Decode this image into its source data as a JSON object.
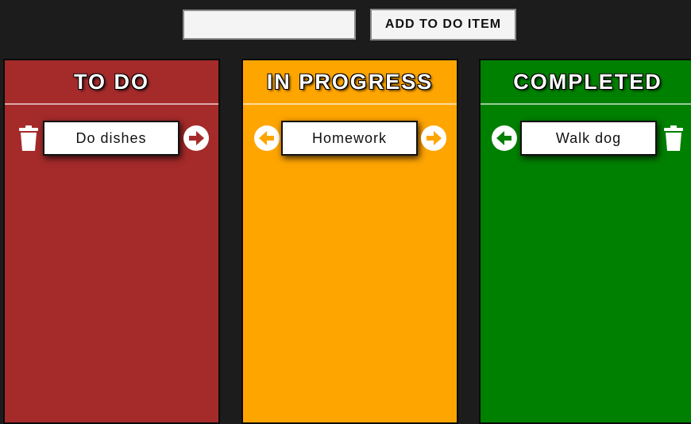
{
  "header": {
    "input_value": "",
    "input_placeholder": "",
    "add_button_label": "ADD TO DO ITEM"
  },
  "columns": [
    {
      "title": "TO DO",
      "color": "#a52a2a",
      "items": [
        {
          "text": "Do dishes"
        }
      ]
    },
    {
      "title": "IN PROGRESS",
      "color": "#ffa500",
      "items": [
        {
          "text": "Homework"
        }
      ]
    },
    {
      "title": "COMPLETED",
      "color": "#008000",
      "items": [
        {
          "text": "Walk dog"
        }
      ]
    }
  ],
  "icons": {
    "delete": "trash-icon",
    "move_forward": "arrow-right-circle-icon",
    "move_back": "arrow-left-circle-icon"
  }
}
